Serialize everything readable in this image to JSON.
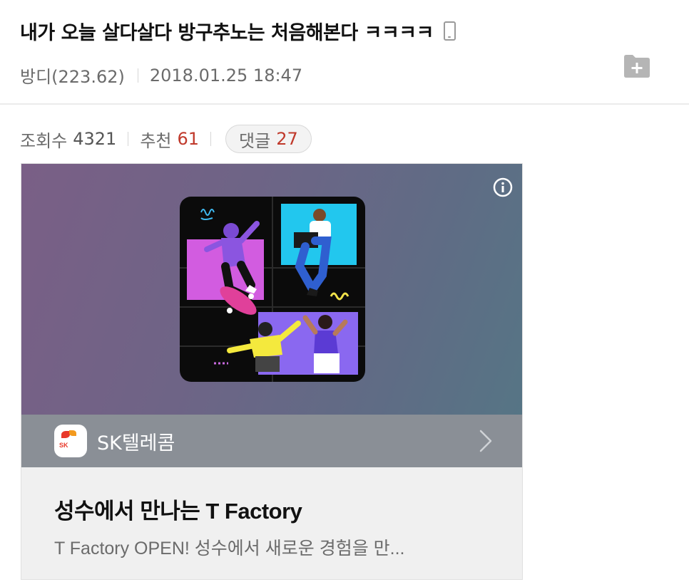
{
  "post": {
    "title": "내가 오늘 살다살다 방구추노는 처음해본다 ㅋㅋㅋㅋ",
    "title_icon": "mobile-phone-icon",
    "author": "방디(223.62)",
    "datetime": "2018.01.25 18:47",
    "folder_icon": "folder-add-icon"
  },
  "stats": {
    "views_label": "조회수",
    "views": "4321",
    "likes_label": "추천",
    "likes": "61",
    "comments_label": "댓글",
    "comments": "27"
  },
  "ad": {
    "advertiser": "SK텔레콤",
    "logo_text": "SK",
    "headline": "성수에서 만나는 T Factory",
    "description": "T Factory OPEN! 성수에서 새로운 경험을 만...",
    "info_icon": "info-icon",
    "chevron_icon": "chevron-right-icon"
  },
  "colors": {
    "accent_red": "#c0392b",
    "banner_start": "#7a5f86",
    "banner_end": "#567585",
    "bar": "#8a8f96"
  }
}
